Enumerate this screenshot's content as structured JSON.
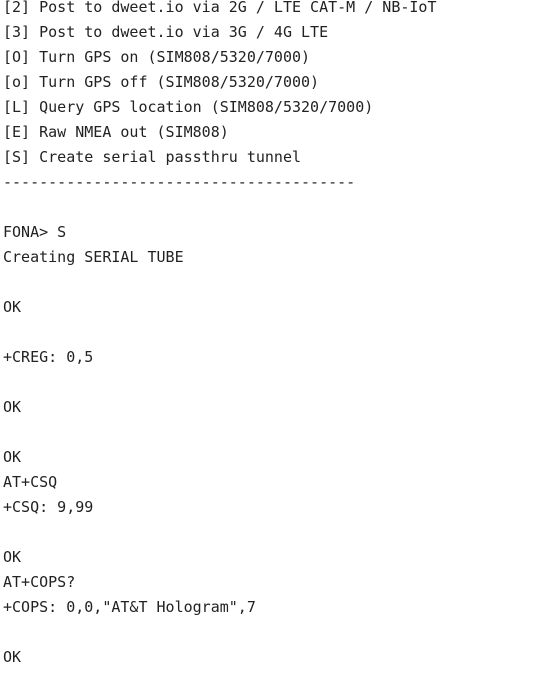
{
  "terminal": {
    "lines": [
      "[2] Post to dweet.io via 2G / LTE CAT-M / NB-IoT",
      "[3] Post to dweet.io via 3G / 4G LTE",
      "[O] Turn GPS on (SIM808/5320/7000)",
      "[o] Turn GPS off (SIM808/5320/7000)",
      "[L] Query GPS location (SIM808/5320/7000)",
      "[E] Raw NMEA out (SIM808)",
      "[S] Create serial passthru tunnel",
      "---------------------------------------",
      "",
      "FONA> S",
      "Creating SERIAL TUBE",
      "",
      "OK",
      "",
      "+CREG: 0,5",
      "",
      "OK",
      "",
      "OK",
      "AT+CSQ",
      "+CSQ: 9,99",
      "",
      "OK",
      "AT+COPS?",
      "+COPS: 0,0,\"AT&T Hologram\",7",
      "",
      "OK"
    ]
  }
}
